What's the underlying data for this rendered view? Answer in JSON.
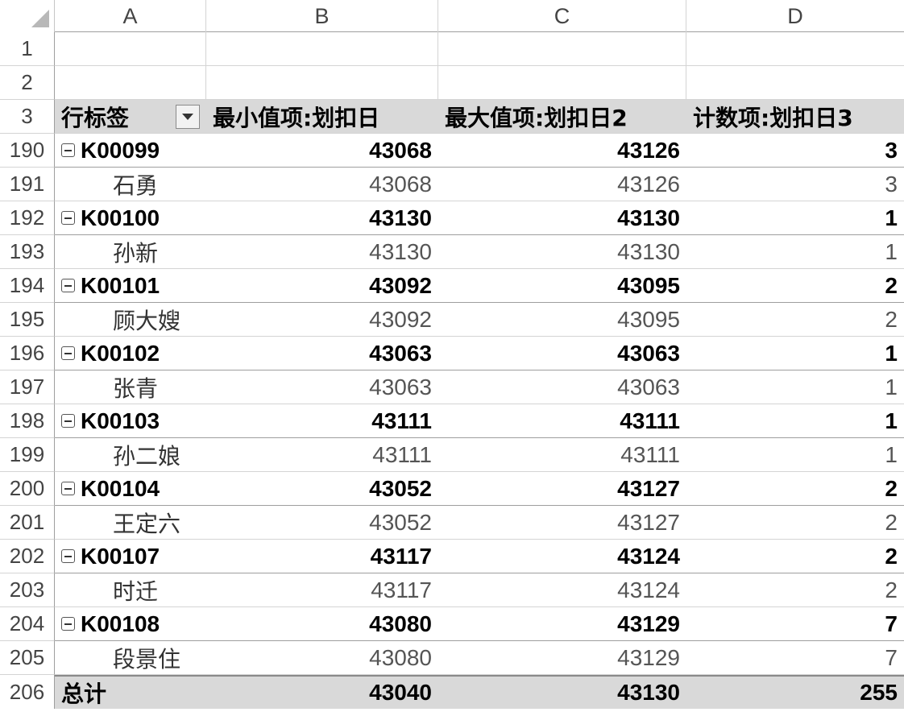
{
  "columns": [
    "A",
    "B",
    "C",
    "D"
  ],
  "header": {
    "row_number": "3",
    "row_labels": "行标签",
    "col_b": "最小值项:划扣日",
    "col_c": "最大值项:划扣日2",
    "col_d": "计数项:划扣日3"
  },
  "blank_rows": [
    "1",
    "2"
  ],
  "groups": [
    {
      "row": "190",
      "key": "K00099",
      "min": "43068",
      "max": "43126",
      "count": "3",
      "detail": {
        "row": "191",
        "name": "石勇",
        "min": "43068",
        "max": "43126",
        "count": "3"
      }
    },
    {
      "row": "192",
      "key": "K00100",
      "min": "43130",
      "max": "43130",
      "count": "1",
      "detail": {
        "row": "193",
        "name": "孙新",
        "min": "43130",
        "max": "43130",
        "count": "1"
      }
    },
    {
      "row": "194",
      "key": "K00101",
      "min": "43092",
      "max": "43095",
      "count": "2",
      "detail": {
        "row": "195",
        "name": "顾大嫂",
        "min": "43092",
        "max": "43095",
        "count": "2"
      }
    },
    {
      "row": "196",
      "key": "K00102",
      "min": "43063",
      "max": "43063",
      "count": "1",
      "detail": {
        "row": "197",
        "name": "张青",
        "min": "43063",
        "max": "43063",
        "count": "1"
      }
    },
    {
      "row": "198",
      "key": "K00103",
      "min": "43111",
      "max": "43111",
      "count": "1",
      "detail": {
        "row": "199",
        "name": "孙二娘",
        "min": "43111",
        "max": "43111",
        "count": "1"
      }
    },
    {
      "row": "200",
      "key": "K00104",
      "min": "43052",
      "max": "43127",
      "count": "2",
      "detail": {
        "row": "201",
        "name": "王定六",
        "min": "43052",
        "max": "43127",
        "count": "2"
      }
    },
    {
      "row": "202",
      "key": "K00107",
      "min": "43117",
      "max": "43124",
      "count": "2",
      "detail": {
        "row": "203",
        "name": "时迁",
        "min": "43117",
        "max": "43124",
        "count": "2"
      }
    },
    {
      "row": "204",
      "key": "K00108",
      "min": "43080",
      "max": "43129",
      "count": "7",
      "detail": {
        "row": "205",
        "name": "段景住",
        "min": "43080",
        "max": "43129",
        "count": "7"
      }
    }
  ],
  "total": {
    "row": "206",
    "label": "总计",
    "min": "43040",
    "max": "43130",
    "count": "255"
  }
}
